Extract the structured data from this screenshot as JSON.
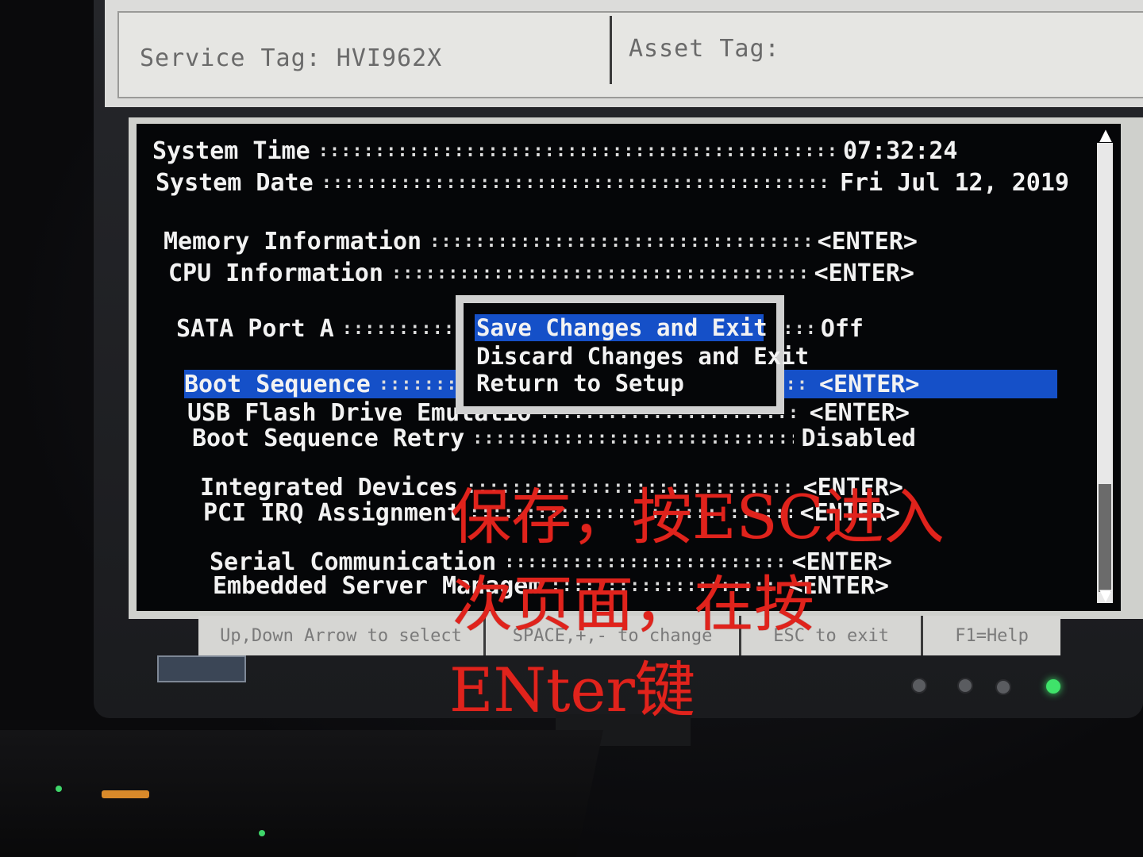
{
  "header": {
    "service_tag": "Service Tag: HVI962X",
    "asset_tag": "Asset Tag:"
  },
  "settings": [
    {
      "label": "System Time",
      "value": "07:32:24"
    },
    {
      "label": "System Date",
      "value": "Fri Jul 12, 2019"
    },
    {
      "label": "Memory Information",
      "value": "<ENTER>"
    },
    {
      "label": "CPU Information",
      "value": "<ENTER>"
    },
    {
      "label": "SATA Port A",
      "value": "Off"
    },
    {
      "label": "Boot Sequence",
      "value": "<ENTER>",
      "selected": true
    },
    {
      "label": "USB Flash Drive Emulatio",
      "value": "<ENTER>"
    },
    {
      "label": "Boot Sequence Retry",
      "value": "Disabled"
    },
    {
      "label": "Integrated Devices",
      "value": "<ENTER>"
    },
    {
      "label": "PCI IRQ Assignment",
      "value": "<ENTER>"
    },
    {
      "label": "Serial Communication",
      "value": "<ENTER>"
    },
    {
      "label": "Embedded Server Managem",
      "value": "<ENTER>"
    }
  ],
  "exit_dialog": {
    "items": [
      "Save Changes and Exit",
      "Discard Changes and Exit",
      "Return to Setup"
    ],
    "selected": "Save Changes and Exit"
  },
  "help_bar": {
    "select": "Up,Down Arrow to select",
    "change": "SPACE,+,- to change",
    "exit": "ESC to exit",
    "help": "F1=Help"
  },
  "annotation": {
    "line1": "保存，按ESC进入",
    "line2": "次页面，在按",
    "line3": "ENter键"
  },
  "colors": {
    "screen_bg": "#050608",
    "highlight": "#1550c8",
    "text": "#f2f2f2",
    "annotation": "#e0231c",
    "power_led": "#3fe36a"
  }
}
